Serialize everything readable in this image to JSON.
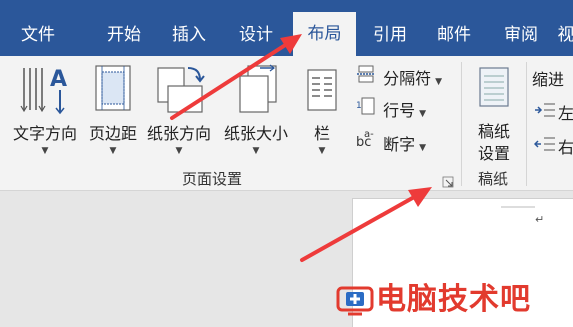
{
  "tabs": [
    {
      "label": "文件"
    },
    {
      "label": "开始"
    },
    {
      "label": "插入"
    },
    {
      "label": "设计"
    },
    {
      "label": "布局"
    },
    {
      "label": "引用"
    },
    {
      "label": "邮件"
    },
    {
      "label": "审阅"
    },
    {
      "label": "视"
    }
  ],
  "ribbon": {
    "text_direction": "文字方向",
    "margins": "页边距",
    "orientation": "纸张方向",
    "size": "纸张大小",
    "columns": "栏",
    "breaks": "分隔符",
    "line_numbers": "行号",
    "hyphenation": "断字",
    "page_setup_group": "页面设置",
    "draft_setup_line1": "稿纸",
    "draft_setup_line2": "设置",
    "draft_group": "稿纸",
    "indent": "缩进",
    "indent_left": "左",
    "indent_right": "右"
  },
  "document": {
    "paragraph_mark": "↵"
  },
  "watermark": {
    "text": "电脑技术吧"
  },
  "colors": {
    "tabbar": "#2b579a",
    "ribbon": "#f3f3f3",
    "arrow": "#ee3b3b",
    "watermark": "#e23a2e"
  }
}
